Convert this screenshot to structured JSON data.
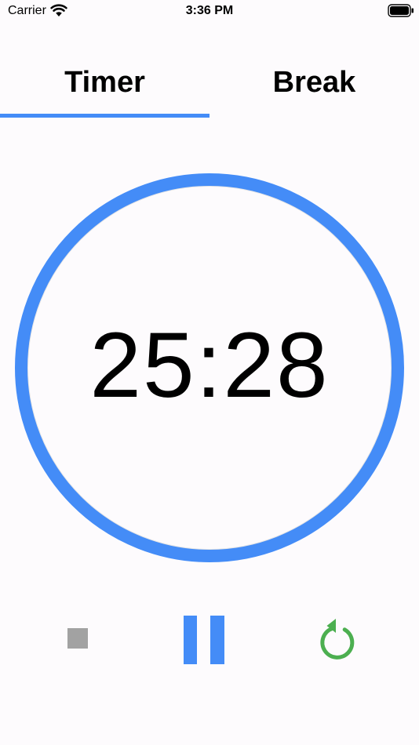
{
  "status_bar": {
    "carrier": "Carrier",
    "time": "3:36 PM",
    "icons": [
      "wifi-icon",
      "battery-icon"
    ]
  },
  "tabs": [
    {
      "label": "Timer",
      "selected": true
    },
    {
      "label": "Break",
      "selected": false
    }
  ],
  "timer": {
    "display": "25:28",
    "progress": 1.0
  },
  "controls": {
    "stop": {
      "icon": "stop-icon"
    },
    "pause": {
      "icon": "pause-icon"
    },
    "reset": {
      "icon": "restart-icon"
    }
  },
  "colors": {
    "accent": "#448cf7",
    "reset": "#4caf50",
    "stop": "#a2a2a2",
    "background": "#fdfbfd"
  }
}
